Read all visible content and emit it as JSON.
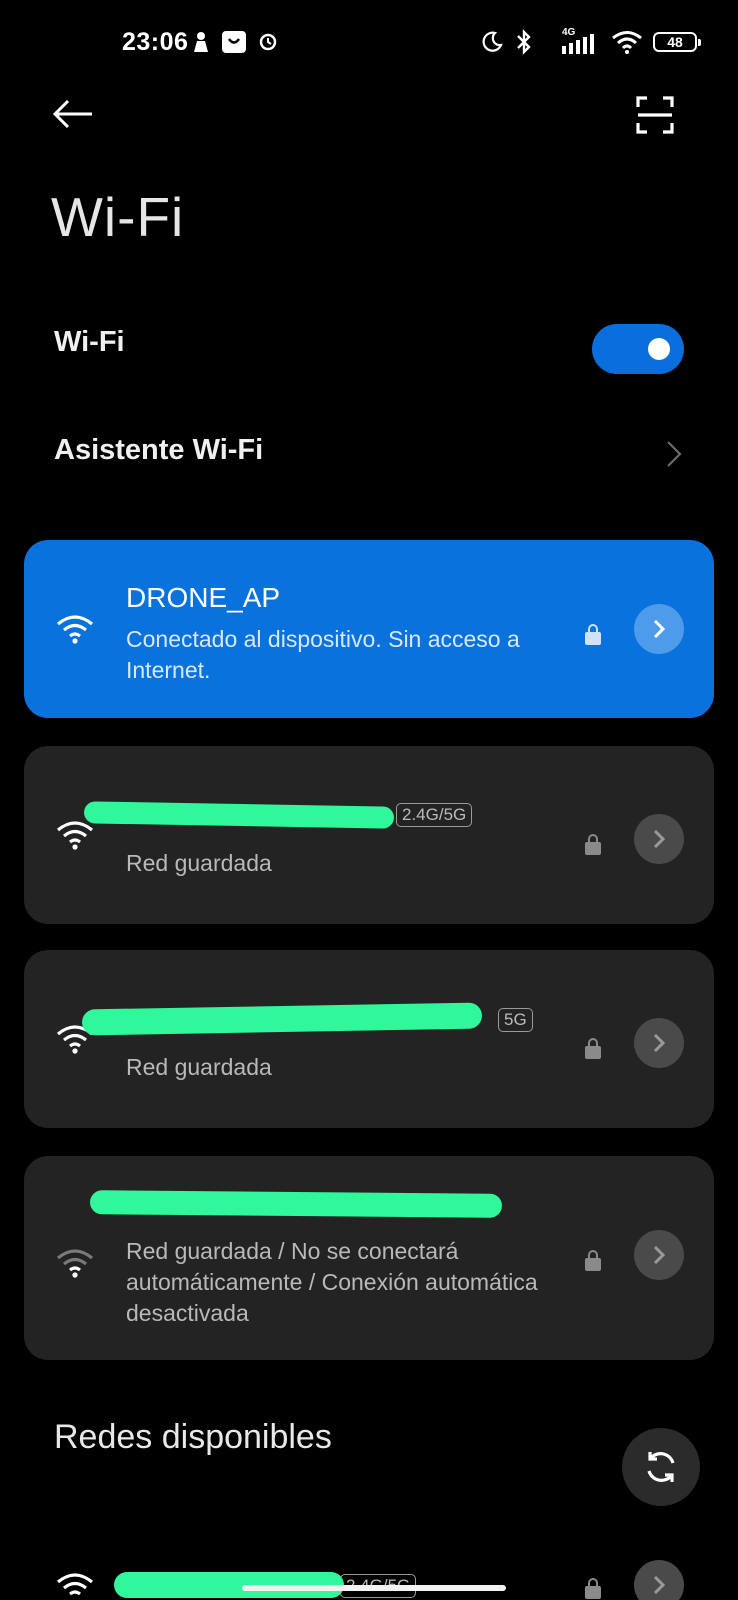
{
  "status_bar": {
    "time": "23:06",
    "network_type": "4G",
    "battery": "48"
  },
  "header": {
    "title": "Wi-Fi"
  },
  "settings": {
    "wifi_label": "Wi-Fi",
    "wifi_enabled": true,
    "assistant_label": "Asistente Wi-Fi"
  },
  "saved_networks": [
    {
      "name": "DRONE_AP",
      "status": "Conectado al dispositivo. Sin acceso a Internet.",
      "band": "",
      "connected": true,
      "signal": "full"
    },
    {
      "name": "",
      "status": "Red guardada",
      "band": "2.4G/5G",
      "connected": false,
      "signal": "full"
    },
    {
      "name": "",
      "status": "Red guardada",
      "band": "5G",
      "connected": false,
      "signal": "full"
    },
    {
      "name": "",
      "status": "Red guardada / No se conectará automáticamente / Conexión automática desactivada",
      "band": "",
      "connected": false,
      "signal": "weak"
    }
  ],
  "available": {
    "section_title": "Redes disponibles",
    "first_band": "2.4G/5G"
  },
  "colors": {
    "accent": "#0a72dd",
    "card_bg": "#232323",
    "redaction": "#2ff79a"
  }
}
